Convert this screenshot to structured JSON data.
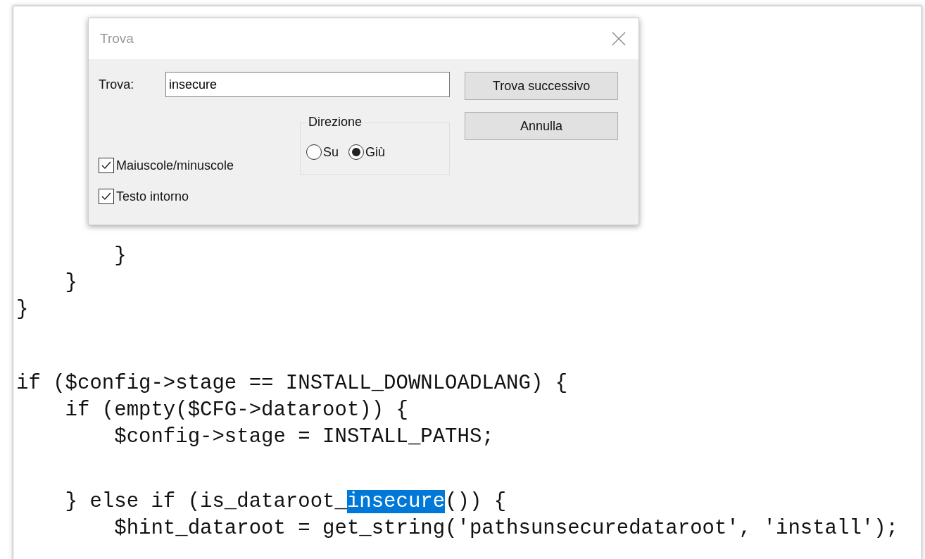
{
  "editor": {
    "blocks": [
      [
        {
          "segments": [
            {
              "text": "        }",
              "selected": false
            }
          ]
        },
        {
          "segments": [
            {
              "text": "    }",
              "selected": false
            }
          ]
        },
        {
          "segments": [
            {
              "text": "}",
              "selected": false
            }
          ]
        }
      ],
      [
        {
          "segments": [
            {
              "text": "if ($config->stage == INSTALL_DOWNLOADLANG) {",
              "selected": false
            }
          ]
        },
        {
          "segments": [
            {
              "text": "    if (empty($CFG->dataroot)) {",
              "selected": false
            }
          ]
        },
        {
          "segments": [
            {
              "text": "        $config->stage = INSTALL_PATHS;",
              "selected": false
            }
          ]
        }
      ],
      [
        {
          "segments": [
            {
              "text": "    } else if (is_dataroot_",
              "selected": false
            },
            {
              "text": "insecure",
              "selected": true
            },
            {
              "text": "()) {",
              "selected": false
            }
          ]
        },
        {
          "segments": [
            {
              "text": "        $hint_dataroot = get_string('pathsunsecuredataroot', 'install');",
              "selected": false
            }
          ]
        }
      ]
    ]
  },
  "dialog": {
    "title": "Trova",
    "find_label": "Trova:",
    "find_value": "insecure",
    "direction": {
      "label": "Direzione",
      "options": [
        {
          "label": "Su",
          "selected": false
        },
        {
          "label": "Giù",
          "selected": true
        }
      ]
    },
    "checkboxes": [
      {
        "label": "Maiuscole/minuscole",
        "checked": true
      },
      {
        "label": "Testo intorno",
        "checked": true
      }
    ],
    "buttons": [
      "Trova successivo",
      "Annulla"
    ]
  }
}
